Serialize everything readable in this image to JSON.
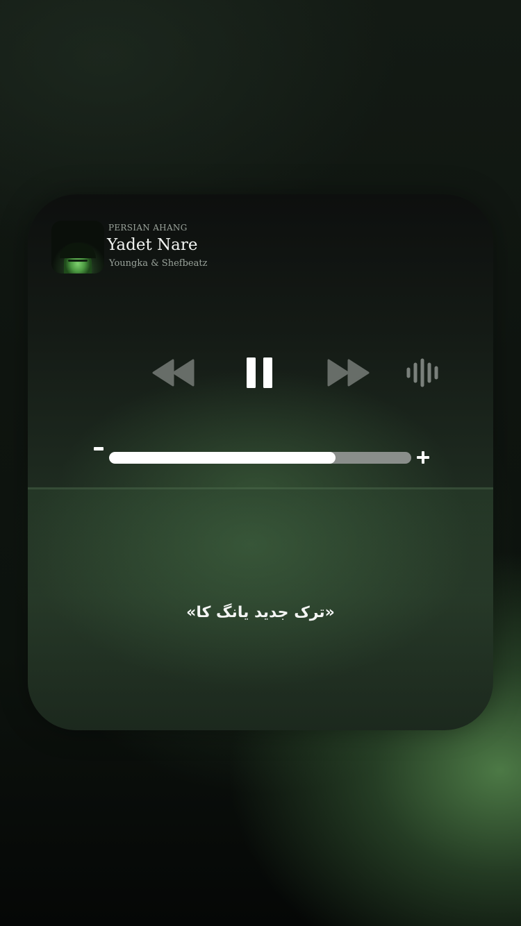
{
  "now_playing": {
    "source": "PERSIAN AHANG",
    "title": "Yadet Nare",
    "artist": "Youngka & Shefbeatz",
    "artwork": "album-art-portrait"
  },
  "controls": {
    "rewind_icon": "rewind-icon",
    "pause_icon": "pause-icon",
    "forward_icon": "fast-forward-icon",
    "waveform_icon": "waveform-icon"
  },
  "volume": {
    "level": 0.75,
    "minus_icon": "volume-down-icon",
    "plus_icon": "volume-up-icon"
  },
  "caption": "«ترک جدید یانگ کا»",
  "colors": {
    "accent_green": "#4f8a4a",
    "track_fill": "#ffffff",
    "track_bg": "#8a8e8b",
    "control_dim": "#6a706b"
  }
}
